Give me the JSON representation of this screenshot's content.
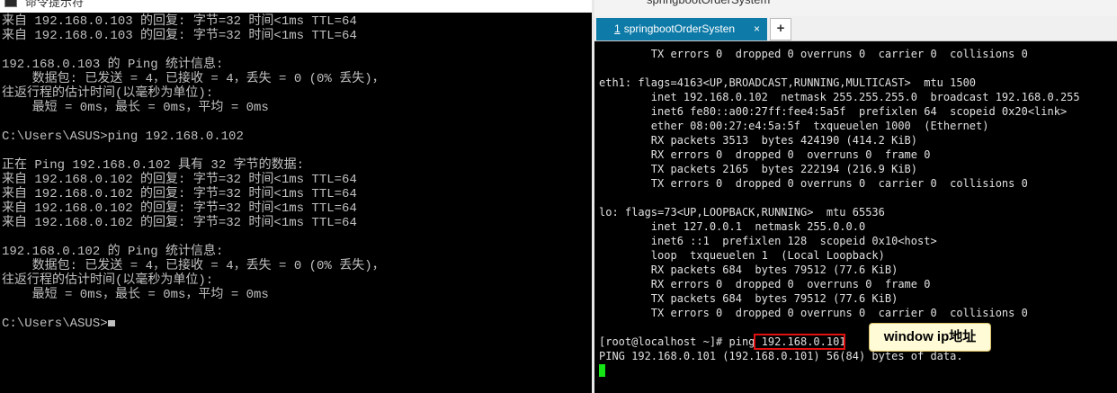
{
  "cmd": {
    "title": "命令提示符",
    "lines": [
      "来自 192.168.0.103 的回复: 字节=32 时间<1ms TTL=64",
      "来自 192.168.0.103 的回复: 字节=32 时间<1ms TTL=64",
      "",
      "192.168.0.103 的 Ping 统计信息:",
      "    数据包: 已发送 = 4，已接收 = 4，丢失 = 0 (0% 丢失)，",
      "往返行程的估计时间(以毫秒为单位):",
      "    最短 = 0ms，最长 = 0ms，平均 = 0ms",
      "",
      "C:\\Users\\ASUS>ping 192.168.0.102",
      "",
      "正在 Ping 192.168.0.102 具有 32 字节的数据:",
      "来自 192.168.0.102 的回复: 字节=32 时间<1ms TTL=64",
      "来自 192.168.0.102 的回复: 字节=32 时间<1ms TTL=64",
      "来自 192.168.0.102 的回复: 字节=32 时间<1ms TTL=64",
      "来自 192.168.0.102 的回复: 字节=32 时间<1ms TTL=64",
      "",
      "192.168.0.102 的 Ping 统计信息:",
      "    数据包: 已发送 = 4，已接收 = 4，丢失 = 0 (0% 丢失)，",
      "往返行程的估计时间(以毫秒为单位):",
      "    最短 = 0ms，最长 = 0ms，平均 = 0ms",
      ""
    ],
    "prompt": "C:\\Users\\ASUS>"
  },
  "terminal": {
    "window_title": "springbootOrderSystem",
    "tab": {
      "number": "1",
      "label": "springbootOrderSysten",
      "close": "×"
    },
    "add_tab": "+",
    "lines": [
      "        TX errors 0  dropped 0 overruns 0  carrier 0  collisions 0",
      "",
      "eth1: flags=4163<UP,BROADCAST,RUNNING,MULTICAST>  mtu 1500",
      "        inet 192.168.0.102  netmask 255.255.255.0  broadcast 192.168.0.255",
      "        inet6 fe80::a00:27ff:fee4:5a5f  prefixlen 64  scopeid 0x20<link>",
      "        ether 08:00:27:e4:5a:5f  txqueuelen 1000  (Ethernet)",
      "        RX packets 3513  bytes 424190 (414.2 KiB)",
      "        RX errors 0  dropped 0  overruns 0  frame 0",
      "        TX packets 2165  bytes 222194 (216.9 KiB)",
      "        TX errors 0  dropped 0 overruns 0  carrier 0  collisions 0",
      "",
      "lo: flags=73<UP,LOOPBACK,RUNNING>  mtu 65536",
      "        inet 127.0.0.1  netmask 255.0.0.0",
      "        inet6 ::1  prefixlen 128  scopeid 0x10<host>",
      "        loop  txqueuelen 1  (Local Loopback)",
      "        RX packets 684  bytes 79512 (77.6 KiB)",
      "        RX errors 0  dropped 0  overruns 0  frame 0",
      "        TX packets 684  bytes 79512 (77.6 KiB)",
      "        TX errors 0  dropped 0 overruns 0  carrier 0  collisions 0",
      "",
      "[root@localhost ~]# ping 192.168.0.101",
      "PING 192.168.0.101 (192.168.0.101) 56(84) bytes of data."
    ]
  },
  "annotation": {
    "label": "window ip地址",
    "highlight_color": "#e11111"
  }
}
